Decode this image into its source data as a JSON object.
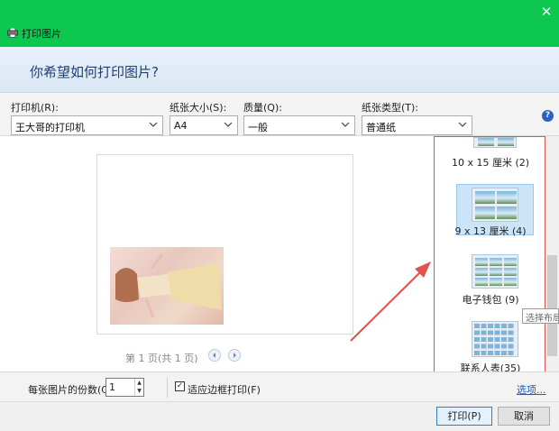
{
  "window": {
    "title": "打印图片",
    "close_glyph": "✕",
    "icon": "printer-icon"
  },
  "header": {
    "question": "你希望如何打印图片?"
  },
  "options": {
    "printer_label": "打印机(R):",
    "printer_value": "王大哥的打印机",
    "paper_size_label": "纸张大小(S):",
    "paper_size_value": "A4",
    "quality_label": "质量(Q):",
    "quality_value": "一般",
    "paper_type_label": "纸张类型(T):",
    "paper_type_value": "普通纸",
    "help_glyph": "?"
  },
  "preview": {
    "page_info": "第 1 页(共 1 页)"
  },
  "layouts": [
    {
      "label": "10 x 15 厘米 (2)",
      "selected": false
    },
    {
      "label": "9 x 13 厘米 (4)",
      "selected": true
    },
    {
      "label": "电子钱包 (9)",
      "selected": false
    },
    {
      "label": "联系人表(35)",
      "selected": false
    }
  ],
  "tooltip": "选择布局",
  "bottom": {
    "copies_label": "每张图片的份数(C):",
    "copies_value": "1",
    "fit_checked_glyph": "✓",
    "fit_label": "适应边框打印(F)",
    "options_link": "选项...",
    "print_button": "打印(P)",
    "cancel_button": "取消"
  },
  "colors": {
    "titlebar": "#0dc84f",
    "highlight_box": "#e2514c",
    "arrow": "#e2514c",
    "link": "#1a5bc4"
  }
}
